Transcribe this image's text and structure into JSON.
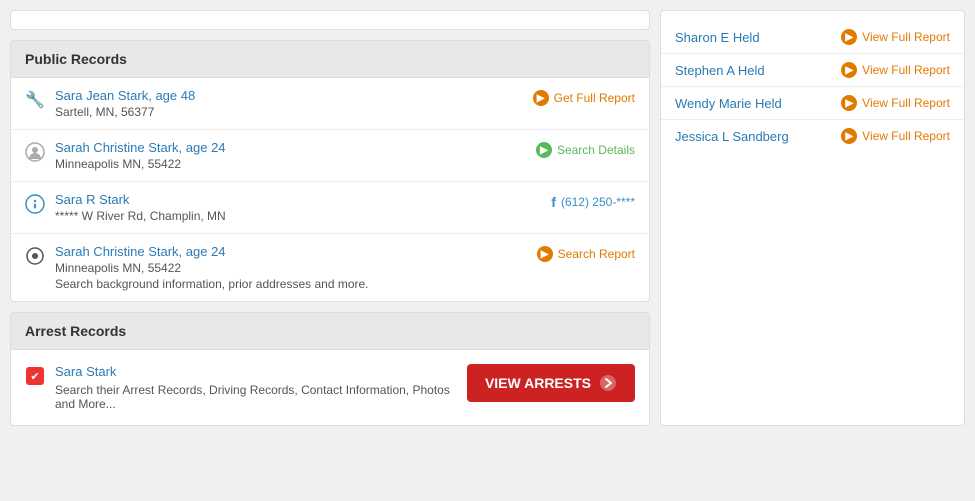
{
  "left": {
    "public_records": {
      "header": "Public Records",
      "items": [
        {
          "name": "Sara Jean Stark, age 48",
          "address": "Sartell, MN, 56377",
          "action_label": "Get Full Report",
          "action_type": "get_full",
          "icon_type": "wrench",
          "description": ""
        },
        {
          "name": "Sarah Christine Stark, age 24",
          "address": "Minneapolis MN, 55422",
          "action_label": "Search Details",
          "action_type": "search_details",
          "icon_type": "person",
          "description": ""
        },
        {
          "name": "Sara R Stark",
          "address": "***** W River Rd, Champlin, MN",
          "action_label": "(612) 250-****",
          "action_type": "phone",
          "icon_type": "info",
          "description": ""
        },
        {
          "name": "Sarah Christine Stark, age 24",
          "address": "Minneapolis MN, 55422",
          "action_label": "Search Report",
          "action_type": "search_report",
          "icon_type": "radio",
          "description": "Search background information, prior addresses and more."
        }
      ]
    },
    "arrest_records": {
      "header": "Arrest Records",
      "name": "Sara Stark",
      "description": "Search their Arrest Records, Driving Records, Contact Information, Photos and More...",
      "button_label": "VIEW ARRESTS"
    }
  },
  "right": {
    "items": [
      {
        "name": "Sharon E Held",
        "action": "View Full Report"
      },
      {
        "name": "Stephen A Held",
        "action": "View Full Report"
      },
      {
        "name": "Wendy Marie Held",
        "action": "View Full Report"
      },
      {
        "name": "Jessica L Sandberg",
        "action": "View Full Report"
      }
    ]
  }
}
